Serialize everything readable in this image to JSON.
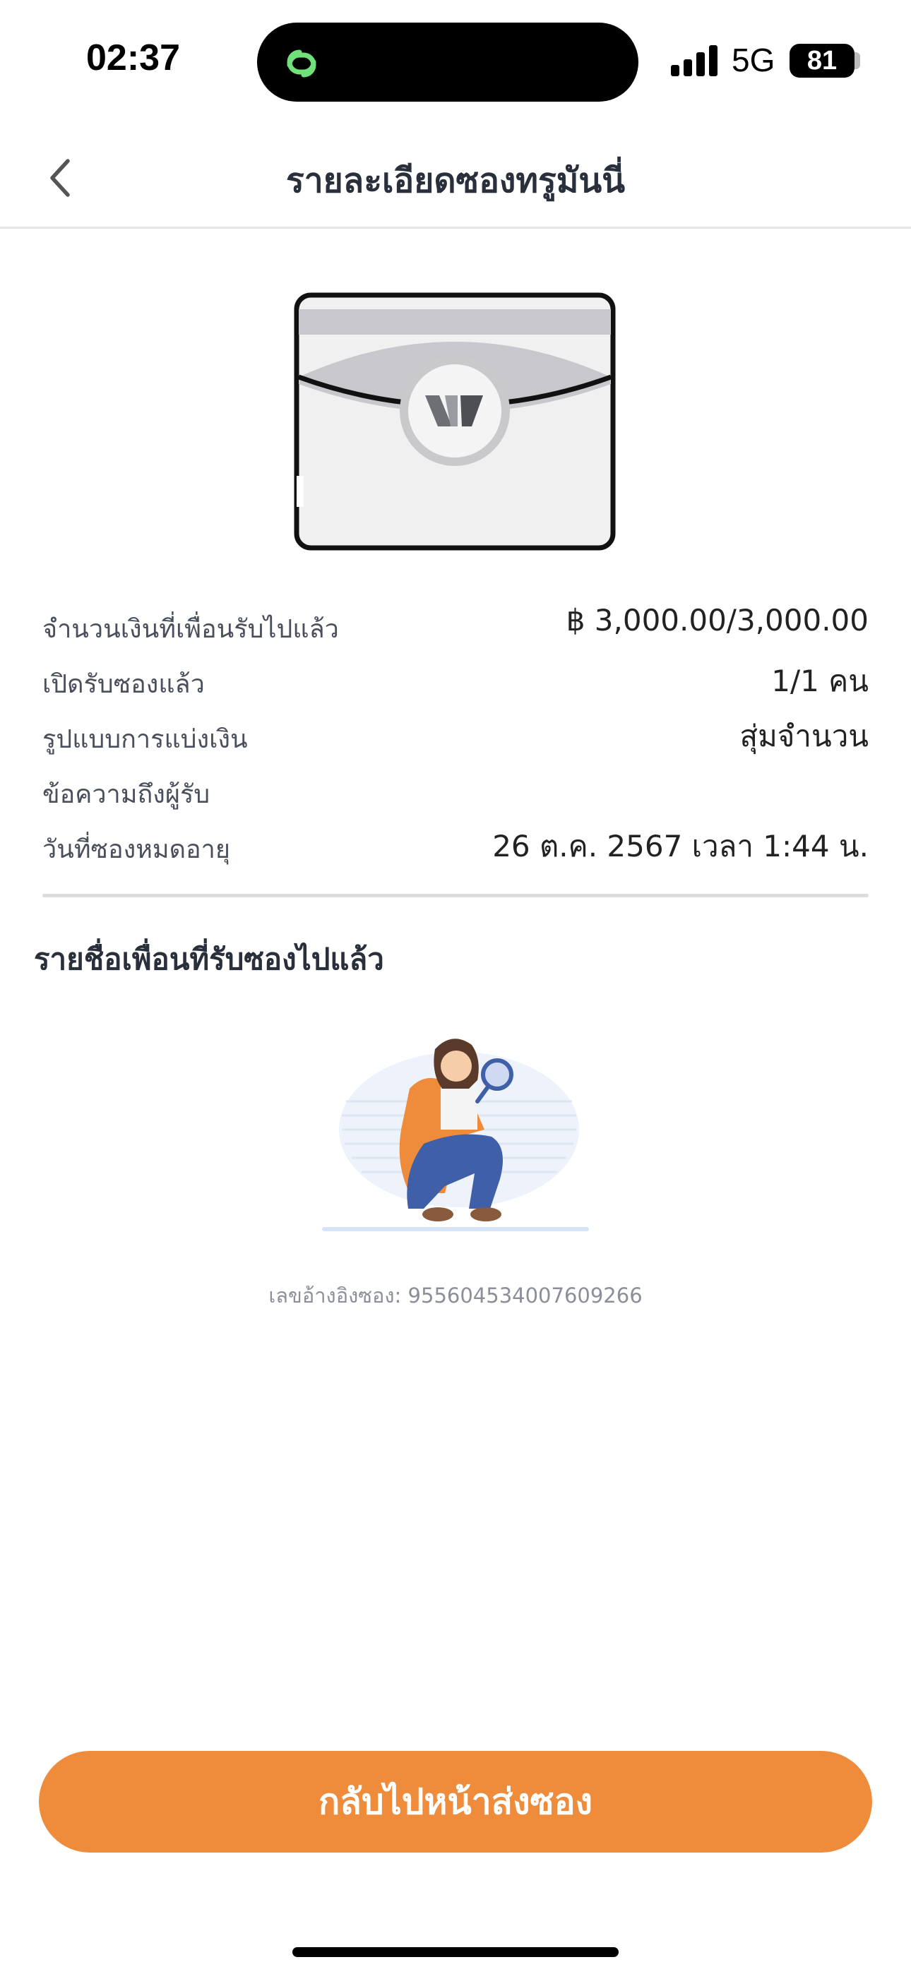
{
  "status_bar": {
    "time": "02:37",
    "network": "5G",
    "battery": "81"
  },
  "header": {
    "title": "รายละเอียดซองทรูมันนี่",
    "back_icon": "chevron-left-icon"
  },
  "details": [
    {
      "label": "จำนวนเงินที่เพื่อนรับไปแล้ว",
      "value": "฿ 3,000.00/3,000.00"
    },
    {
      "label": "เปิดรับซองแล้ว",
      "value": "1/1 คน"
    },
    {
      "label": "รูปแบบการแบ่งเงิน",
      "value": "สุ่มจำนวน"
    },
    {
      "label": "ข้อความถึงผู้รับ",
      "value": ""
    },
    {
      "label": "วันที่ซองหมดอายุ",
      "value": "26 ต.ค. 2567 เวลา 1:44 น."
    }
  ],
  "recipients": {
    "title": "รายชื่อเพื่อนที่รับซองไปแล้ว",
    "reference": "เลขอ้างอิงซอง: 955604534007609266"
  },
  "actions": {
    "primary_label": "กลับไปหน้าส่งซอง"
  },
  "colors": {
    "accent": "#ee8c3c",
    "title": "#2a2f3c",
    "label": "#4a4f5c",
    "muted": "#8a8f99"
  }
}
